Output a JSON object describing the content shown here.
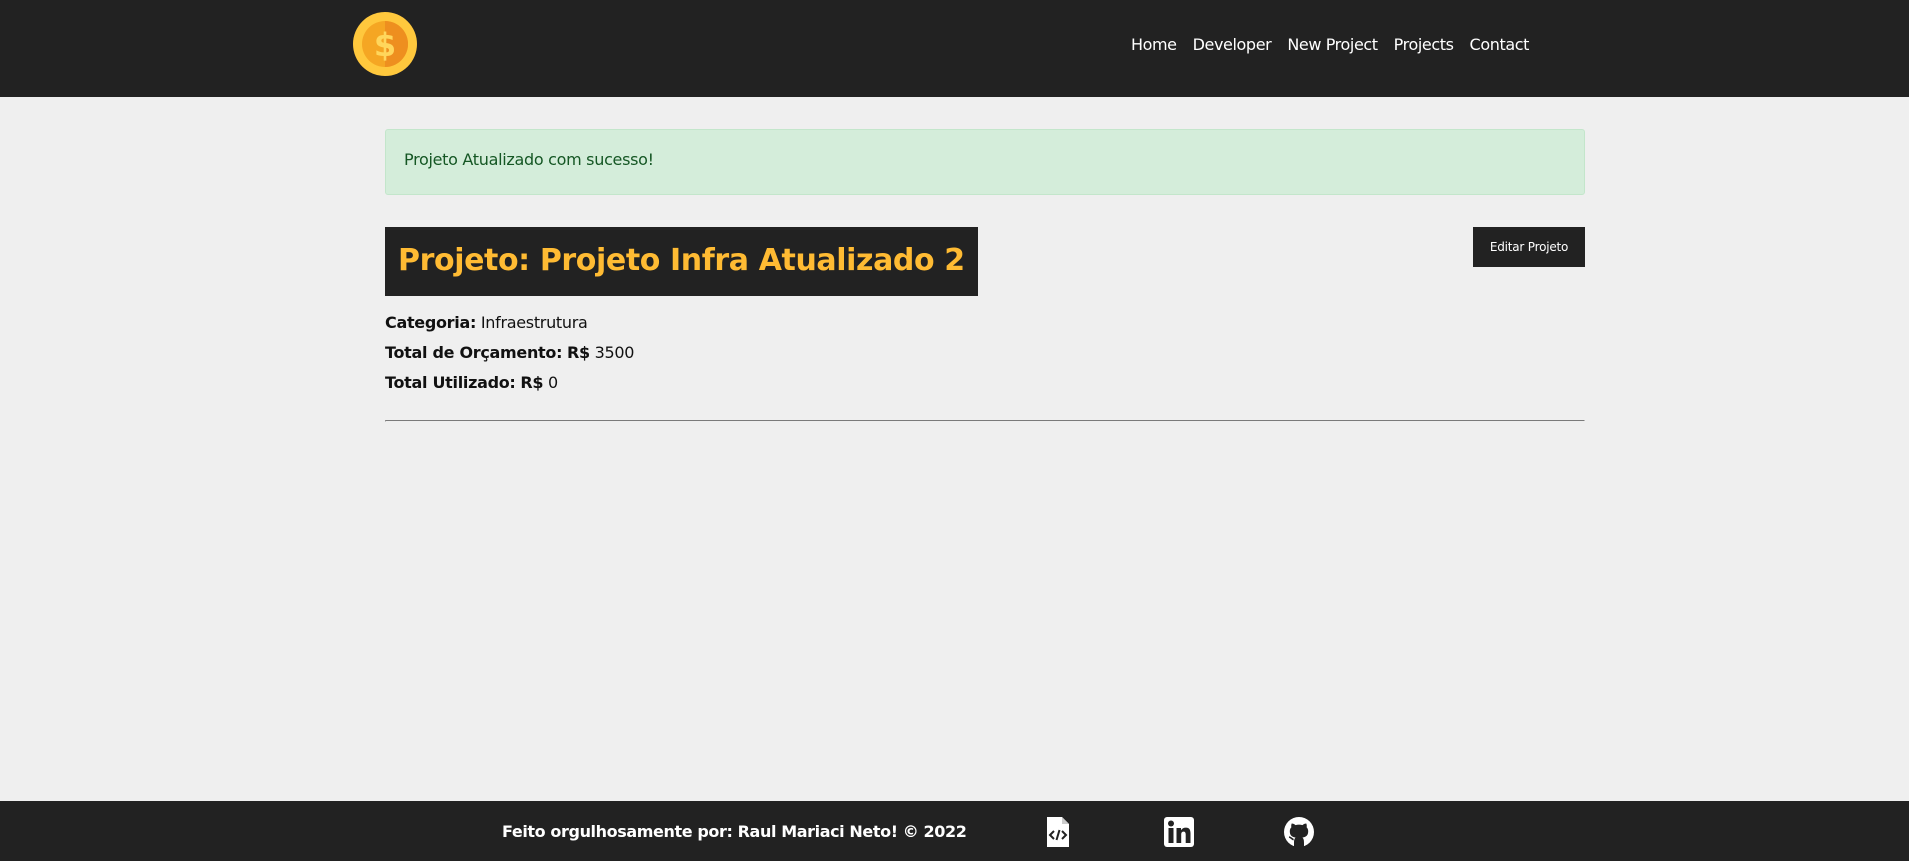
{
  "nav": {
    "items": [
      {
        "label": "Home"
      },
      {
        "label": "Developer"
      },
      {
        "label": "New Project"
      },
      {
        "label": "Projects"
      },
      {
        "label": "Contact"
      }
    ]
  },
  "alert": {
    "message": "Projeto Atualizado com sucesso!"
  },
  "project": {
    "title": "Projeto: Projeto Infra Atualizado 2",
    "edit_label": "Editar Projeto",
    "category_label": "Categoria:",
    "category_value": "Infraestrutura",
    "budget_label": "Total de Orçamento:",
    "budget_currency": "R$",
    "budget_value": "3500",
    "used_label": "Total Utilizado:",
    "used_currency": "R$",
    "used_value": "0"
  },
  "footer": {
    "text": "Feito orgulhosamente por: Raul Mariaci Neto! © 2022",
    "icons": [
      "code-file-icon",
      "linkedin-icon",
      "github-icon"
    ]
  },
  "colors": {
    "dark": "#222222",
    "accent": "#ffbb33",
    "background": "#efefef",
    "alert_bg": "#d4edda",
    "alert_text": "#155724"
  }
}
